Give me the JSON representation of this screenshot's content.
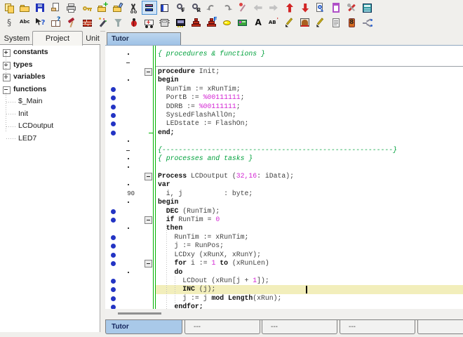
{
  "colors": {
    "accent_tab_blue": "#a9c9e9",
    "comment_green": "#00a13c",
    "number_magenta": "#d428d4",
    "keyword_black": "#0f0f0f",
    "highlight_line": "#f2eebb",
    "gutter_dot_blue": "#2334c4",
    "fold_line_green": "#00b400"
  },
  "toolbar": {
    "highlighted_icon": "window-tile-icon",
    "rows": [
      [
        "copy-files-icon",
        "open-folder-icon",
        "save-icon",
        "send-page-icon",
        "print-icon",
        "key-icon",
        "folder-add-icon",
        "folder-brush-icon",
        "cut-icon",
        "window-tile-icon",
        "window-vertical-icon",
        "find-icon",
        "replace-icon",
        "undo-icon",
        "redo-icon",
        "pin-icon",
        "arrow-left-icon",
        "arrow-right-icon",
        "arrow-up-icon",
        "arrow-down-icon",
        "doc-preview-icon",
        "doc-purple-icon",
        "tools-icon",
        "calculator-icon"
      ],
      [
        "clamp-icon",
        "spellcheck-icon",
        "help-cursor-icon",
        "help-book-icon",
        "hammer-icon",
        "brick-wall-icon",
        "magic-wand-icon",
        "funnel-icon",
        "debug-bug-icon",
        "ambulance-icon",
        "eprom-icon",
        "memory-chip-icon",
        "brick-steps-icon",
        "brick-steps-f-icon",
        "led-yellow-icon",
        "lcd-green-icon",
        "font-a-icon",
        "font-ab-icon",
        "pen-icon",
        "arch-window-icon",
        "pen2-icon",
        "notepad-icon",
        "speaker-icon",
        "fork-connector-icon"
      ]
    ]
  },
  "left_panel": {
    "tabs": [
      "System",
      "Project",
      "Unit"
    ],
    "active_tab": "Project",
    "tree": [
      {
        "label": "constants",
        "state": "collapsed"
      },
      {
        "label": "types",
        "state": "collapsed"
      },
      {
        "label": "variables",
        "state": "collapsed"
      },
      {
        "label": "functions",
        "state": "expanded",
        "children": [
          "$_Main",
          "Init",
          "LCDoutput",
          "LED7"
        ]
      }
    ]
  },
  "editor": {
    "tab": "Tutor",
    "gutter_number": "90",
    "lines": [
      {
        "g": "dot",
        "tk": [
          [
            "c",
            "{ procedures & functions }"
          ]
        ]
      },
      {
        "g": "dash",
        "tk": []
      },
      {
        "g": "",
        "fold": true,
        "sep": true,
        "tk": [
          [
            "k",
            "procedure"
          ],
          [
            "p",
            " Init;"
          ]
        ]
      },
      {
        "g": "dot",
        "tk": [
          [
            "k",
            "begin"
          ]
        ]
      },
      {
        "g": "blue",
        "tk": [
          [
            "p",
            "  RunTim := xRunTim;"
          ]
        ]
      },
      {
        "g": "blue",
        "tk": [
          [
            "p",
            "  PortB := "
          ],
          [
            "n",
            "%00111111"
          ],
          [
            "p",
            ";"
          ]
        ]
      },
      {
        "g": "blue",
        "tk": [
          [
            "p",
            "  DDRB := "
          ],
          [
            "n",
            "%00111111"
          ],
          [
            "p",
            ";"
          ]
        ]
      },
      {
        "g": "blue",
        "tk": [
          [
            "p",
            "  SysLedFlashAllOn;"
          ]
        ]
      },
      {
        "g": "blue",
        "tk": [
          [
            "p",
            "  LEDstate := FlashOn;"
          ]
        ]
      },
      {
        "g": "blue",
        "tick": true,
        "tk": [
          [
            "k",
            "end;"
          ]
        ]
      },
      {
        "g": "dot",
        "tk": []
      },
      {
        "g": "dash",
        "tk": [
          [
            "c",
            "{--------------------------------------------------------}"
          ]
        ]
      },
      {
        "g": "dot",
        "tk": [
          [
            "c",
            "{ processes and tasks }"
          ]
        ]
      },
      {
        "g": "dot",
        "tk": []
      },
      {
        "g": "",
        "fold": true,
        "tk": [
          [
            "k",
            "Process"
          ],
          [
            "p",
            " LCDoutput ("
          ],
          [
            "n",
            "32,16"
          ],
          [
            "p",
            ": iData);"
          ]
        ]
      },
      {
        "g": "dot",
        "tk": [
          [
            "k",
            "var"
          ]
        ]
      },
      {
        "g": "num",
        "tk": [
          [
            "p",
            "  i, j          : byte;"
          ]
        ]
      },
      {
        "g": "dot",
        "tk": [
          [
            "k",
            "begin"
          ]
        ]
      },
      {
        "g": "blue",
        "tk": [
          [
            "p",
            "  "
          ],
          [
            "k",
            "DEC"
          ],
          [
            "p",
            " (RunTim);"
          ]
        ]
      },
      {
        "g": "blue",
        "fold": true,
        "tk": [
          [
            "p",
            "  "
          ],
          [
            "k",
            "if"
          ],
          [
            "p",
            " RunTim = "
          ],
          [
            "n",
            "0"
          ]
        ]
      },
      {
        "g": "dot",
        "tk": [
          [
            "p",
            "  "
          ],
          [
            "k",
            "then"
          ]
        ]
      },
      {
        "g": "blue",
        "tk": [
          [
            "p",
            "    RunTim := xRunTim;"
          ]
        ]
      },
      {
        "g": "blue",
        "tk": [
          [
            "p",
            "    j := RunPos;"
          ]
        ]
      },
      {
        "g": "blue",
        "tk": [
          [
            "p",
            "    LCDxy (xRunX, xRunY);"
          ]
        ]
      },
      {
        "g": "blue",
        "fold": true,
        "tk": [
          [
            "p",
            "    "
          ],
          [
            "k",
            "for"
          ],
          [
            "p",
            " i := "
          ],
          [
            "n",
            "1"
          ],
          [
            "p",
            " "
          ],
          [
            "k",
            "to"
          ],
          [
            "p",
            " (xRunLen)"
          ]
        ]
      },
      {
        "g": "dot",
        "tk": [
          [
            "p",
            "    "
          ],
          [
            "k",
            "do"
          ]
        ]
      },
      {
        "g": "blue",
        "tk": [
          [
            "p",
            "      LCDout (xRun[j + "
          ],
          [
            "n",
            "1"
          ],
          [
            "p",
            "]);"
          ]
        ]
      },
      {
        "g": "blue",
        "hl": true,
        "cur": 286,
        "tk": [
          [
            "p",
            "      "
          ],
          [
            "k",
            "INC"
          ],
          [
            "p",
            " (j);"
          ]
        ]
      },
      {
        "g": "blue",
        "tk": [
          [
            "p",
            "      j := j "
          ],
          [
            "k",
            "mod"
          ],
          [
            "p",
            " "
          ],
          [
            "k",
            "Length"
          ],
          [
            "p",
            "(xRun);"
          ]
        ]
      },
      {
        "g": "blue",
        "tk": [
          [
            "p",
            "    "
          ],
          [
            "k",
            "endfor;"
          ]
        ]
      }
    ]
  },
  "bottom_tabs": [
    {
      "label": "Tutor",
      "active": true
    },
    {
      "label": "---",
      "active": false
    },
    {
      "label": "---",
      "active": false
    },
    {
      "label": "---",
      "active": false
    },
    {
      "label": "",
      "active": false
    }
  ]
}
